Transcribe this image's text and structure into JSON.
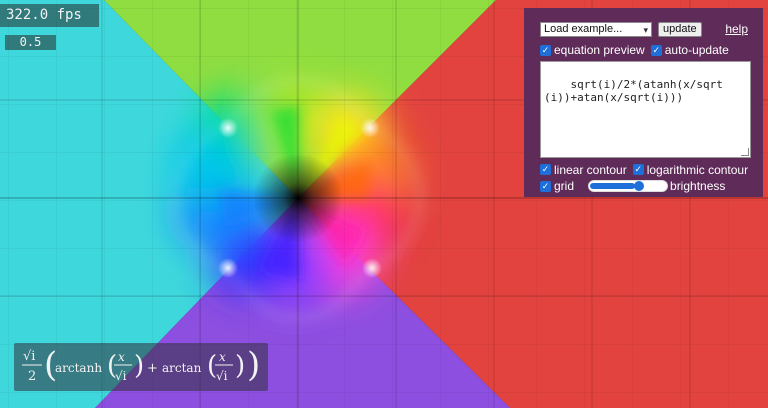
{
  "fps": "322.0 fps",
  "value": "0.5",
  "panel": {
    "example_select": "Load example...",
    "update_label": "update",
    "help_label": "help",
    "equation_preview_label": "equation preview",
    "auto_update_label": "auto-update",
    "equation_text": "sqrt(i)/2*(atanh(x/sqrt(i))+atan(x/sqrt(i)))",
    "linear_contour_label": "linear contour",
    "logarithmic_contour_label": "logarithmic contour",
    "grid_label": "grid",
    "brightness_label": "brightness",
    "checkboxes": {
      "equation_preview": true,
      "auto_update": true,
      "linear_contour": true,
      "logarithmic_contour": true,
      "grid": true
    },
    "brightness_level": 0.66
  },
  "formula": {
    "sqrt_i": "√i",
    "two": "2",
    "arctanh": "arctanh",
    "arctan": "arctan",
    "plus": "+",
    "x": "x"
  },
  "colors": {
    "cyan": "#3ed8dc",
    "green": "#8fdd41",
    "red": "#e2433f",
    "purple": "#8d4fe0",
    "panel_bg": "#5f2b59",
    "checkbox": "#1e6fd9"
  }
}
